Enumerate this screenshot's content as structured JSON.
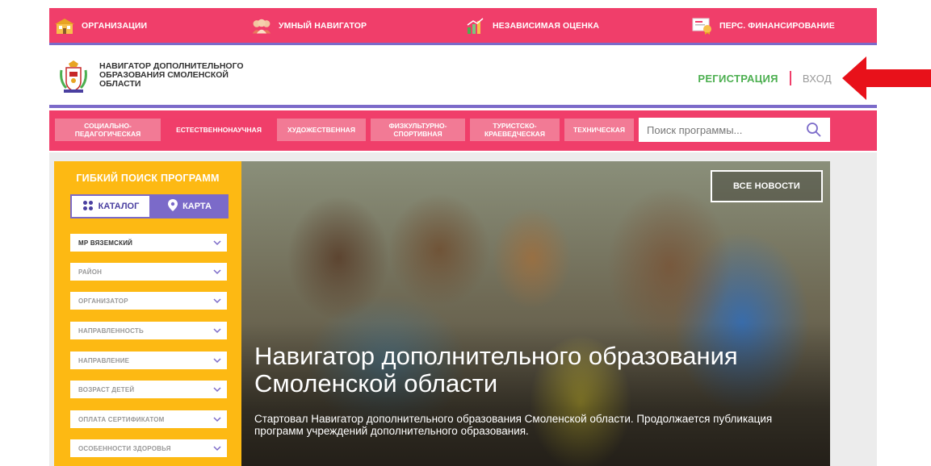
{
  "topnav": [
    {
      "label": "ОРГАНИЗАЦИИ",
      "icon": "school-building-icon"
    },
    {
      "label": "УМНЫЙ НАВИГАТОР",
      "icon": "people-icon"
    },
    {
      "label": "НЕЗАВИСИМАЯ ОЦЕНКА",
      "icon": "bar-chart-icon"
    },
    {
      "label": "ПЕРС. ФИНАНСИРОВАНИЕ",
      "icon": "certificate-icon"
    }
  ],
  "brand": {
    "line1": "НАВИГАТОР ДОПОЛНИТЕЛЬНОГО",
    "line2": "ОБРАЗОВАНИЯ СМОЛЕНСКОЙ",
    "line3": "ОБЛАСТИ"
  },
  "auth": {
    "register": "РЕГИСТРАЦИЯ",
    "login": "ВХОД"
  },
  "categories": [
    "СОЦИАЛЬНО-ПЕДАГОГИЧЕСКАЯ",
    "ЕСТЕСТВЕННОНАУЧНАЯ",
    "ХУДОЖЕСТВЕННАЯ",
    "ФИЗКУЛЬТУРНО-СПОРТИВНАЯ",
    "ТУРИСТСКО-КРАЕВЕДЧЕСКАЯ",
    "ТЕХНИЧЕСКАЯ"
  ],
  "search": {
    "placeholder": "Поиск программы..."
  },
  "filters": {
    "title": "ГИБКИЙ ПОИСК ПРОГРАММ",
    "tab_catalog": "КАТАЛОГ",
    "tab_map": "КАРТА",
    "dropdowns": [
      "МР ВЯЗЕМСКИЙ",
      "РАЙОН",
      "ОРГАНИЗАТОР",
      "НАПРАВЛЕННОСТЬ",
      "НАПРАВЛЕНИЕ",
      "ВОЗРАСТ ДЕТЕЙ",
      "ОПЛАТА СЕРТИФИКАТОМ",
      "ОСОБЕННОСТИ ЗДОРОВЬЯ"
    ]
  },
  "hero": {
    "news_button": "ВСЕ НОВОСТИ",
    "title": "Навигатор дополнительного образования Смоленской области",
    "text": "Стартовал Навигатор дополнительного образования Смоленской области. Продолжается публикация программ учреждений дополнительного образования."
  },
  "colors": {
    "primary_pink": "#f03e6a",
    "purple": "#7b6ac9",
    "yellow": "#fdb913",
    "green": "#4caf50",
    "arrow_red": "#e8111a"
  }
}
